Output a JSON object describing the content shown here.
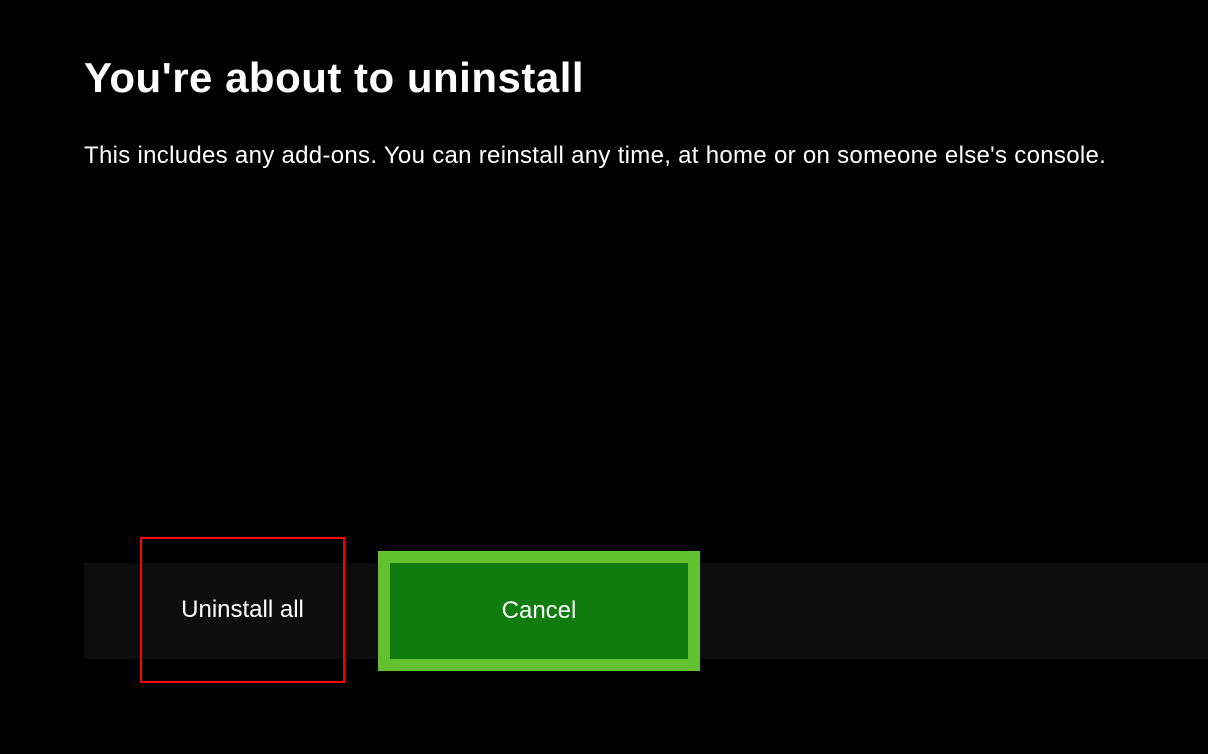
{
  "dialog": {
    "title": "You're about to uninstall",
    "description": "This includes any add-ons. You can reinstall any time, at home or on someone else's console."
  },
  "buttons": {
    "uninstall_label": "Uninstall all",
    "cancel_label": "Cancel"
  }
}
